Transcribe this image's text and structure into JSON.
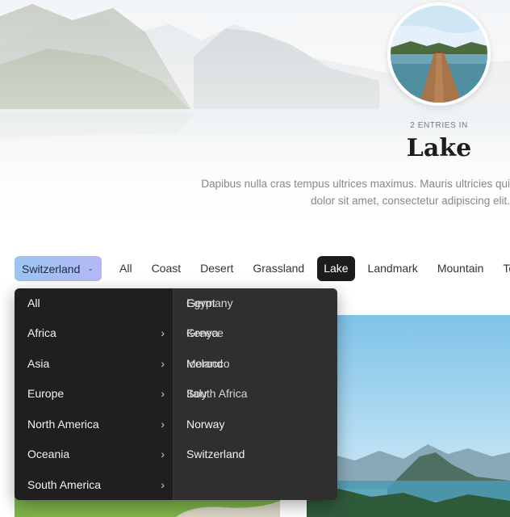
{
  "hero": {
    "entries_label": "2 ENTRIES IN",
    "title": "Lake",
    "description_line1": "Dapibus nulla cras tempus ultrices maximus. Mauris ultricies qui",
    "description_line2": "dolor sit amet, consectetur adipiscing elit."
  },
  "filter": {
    "country_label": "Switzerland",
    "tabs": [
      "All",
      "Coast",
      "Desert",
      "Grassland",
      "Lake",
      "Landmark",
      "Mountain",
      "Tov"
    ],
    "active_tab": "Lake"
  },
  "menu": {
    "regions": [
      "All",
      "Africa",
      "Asia",
      "Europe",
      "North America",
      "Oceania",
      "South America"
    ],
    "countries": [
      {
        "label": "Germany",
        "overlap": "Egypt"
      },
      {
        "label": "Greece",
        "overlap": "Kenya"
      },
      {
        "label": "Iceland",
        "overlap": "Morocco"
      },
      {
        "label": "Italy",
        "overlap": "South Africa"
      },
      {
        "label": "Norway"
      },
      {
        "label": "Switzerland"
      }
    ],
    "arrow_glyph": "›"
  },
  "icons": {
    "chevron": "chevron-down-icon",
    "submenu": "chevron-right-icon"
  },
  "colors": {
    "accent_gradient_start": "#9cc4f2",
    "accent_gradient_end": "#b4b8f6",
    "menu_bg": "#1f1f1f",
    "submenu_bg": "#2f2f2f",
    "active_tab_bg": "#1c1c1c"
  }
}
